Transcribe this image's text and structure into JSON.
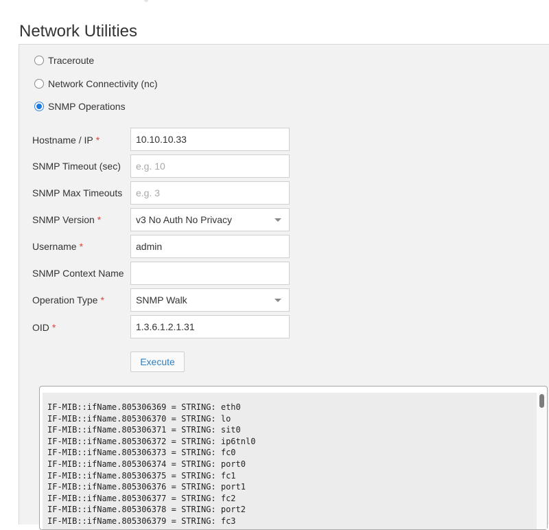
{
  "page": {
    "title": "Network Utilities"
  },
  "radios": [
    {
      "label": "Traceroute",
      "checked": false
    },
    {
      "label": "Network Connectivity (nc)",
      "checked": false
    },
    {
      "label": "SNMP Operations",
      "checked": true
    }
  ],
  "form": {
    "required_mark": "*",
    "hostname": {
      "label": "Hostname / IP",
      "value": "10.10.10.33",
      "placeholder": ""
    },
    "timeout": {
      "label": "SNMP Timeout (sec)",
      "value": "",
      "placeholder": "e.g. 10"
    },
    "max_timeouts": {
      "label": "SNMP Max Timeouts",
      "value": "",
      "placeholder": "e.g. 3"
    },
    "version": {
      "label": "SNMP Version",
      "selected": "v3 No Auth No Privacy"
    },
    "username": {
      "label": "Username",
      "value": "admin",
      "placeholder": ""
    },
    "context_name": {
      "label": "SNMP Context Name",
      "value": "",
      "placeholder": ""
    },
    "operation_type": {
      "label": "Operation Type",
      "selected": "SNMP Walk"
    },
    "oid": {
      "label": "OID",
      "value": "1.3.6.1.2.1.31",
      "placeholder": ""
    },
    "execute_label": "Execute"
  },
  "output": {
    "lines": [
      "IF-MIB::ifName.805306369 = STRING: eth0",
      "IF-MIB::ifName.805306370 = STRING: lo",
      "IF-MIB::ifName.805306371 = STRING: sit0",
      "IF-MIB::ifName.805306372 = STRING: ip6tnl0",
      "IF-MIB::ifName.805306373 = STRING: fc0",
      "IF-MIB::ifName.805306374 = STRING: port0",
      "IF-MIB::ifName.805306375 = STRING: fc1",
      "IF-MIB::ifName.805306376 = STRING: port1",
      "IF-MIB::ifName.805306377 = STRING: fc2",
      "IF-MIB::ifName.805306378 = STRING: port2",
      "IF-MIB::ifName.805306379 = STRING: fc3"
    ]
  },
  "colors": {
    "accent": "#1c7ae0",
    "required": "#d9453b",
    "link": "#2f7fbf",
    "panel_bg": "#f2f2f2"
  },
  "icons": {
    "select_caret": "chevron-down-icon",
    "radio": "radio-icon"
  }
}
